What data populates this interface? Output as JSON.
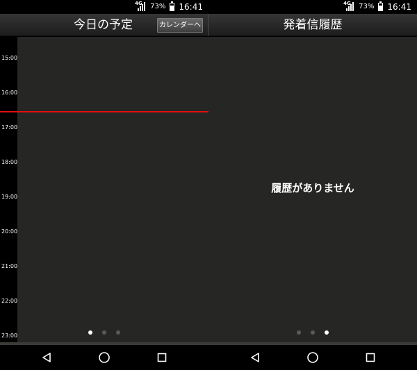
{
  "status_bar": {
    "network": "4G",
    "battery_percent": "73%",
    "battery_level": 0.73,
    "time": "16:41"
  },
  "schedule": {
    "title": "今日の予定",
    "calendar_button_label": "カレンダーへ",
    "hours": [
      "15:00",
      "16:00",
      "17:00",
      "18:00",
      "19:00",
      "20:00",
      "21:00",
      "22:00",
      "23:00"
    ],
    "current_time_line_color": "#e01010"
  },
  "call_history": {
    "title": "発着信履歴",
    "empty_message": "履歴がありません"
  },
  "page_indicator": {
    "count": 3,
    "left_active_index": 0,
    "right_active_index": 2
  },
  "navigation": {
    "buttons": [
      "back-icon",
      "home-icon",
      "recents-icon"
    ]
  }
}
